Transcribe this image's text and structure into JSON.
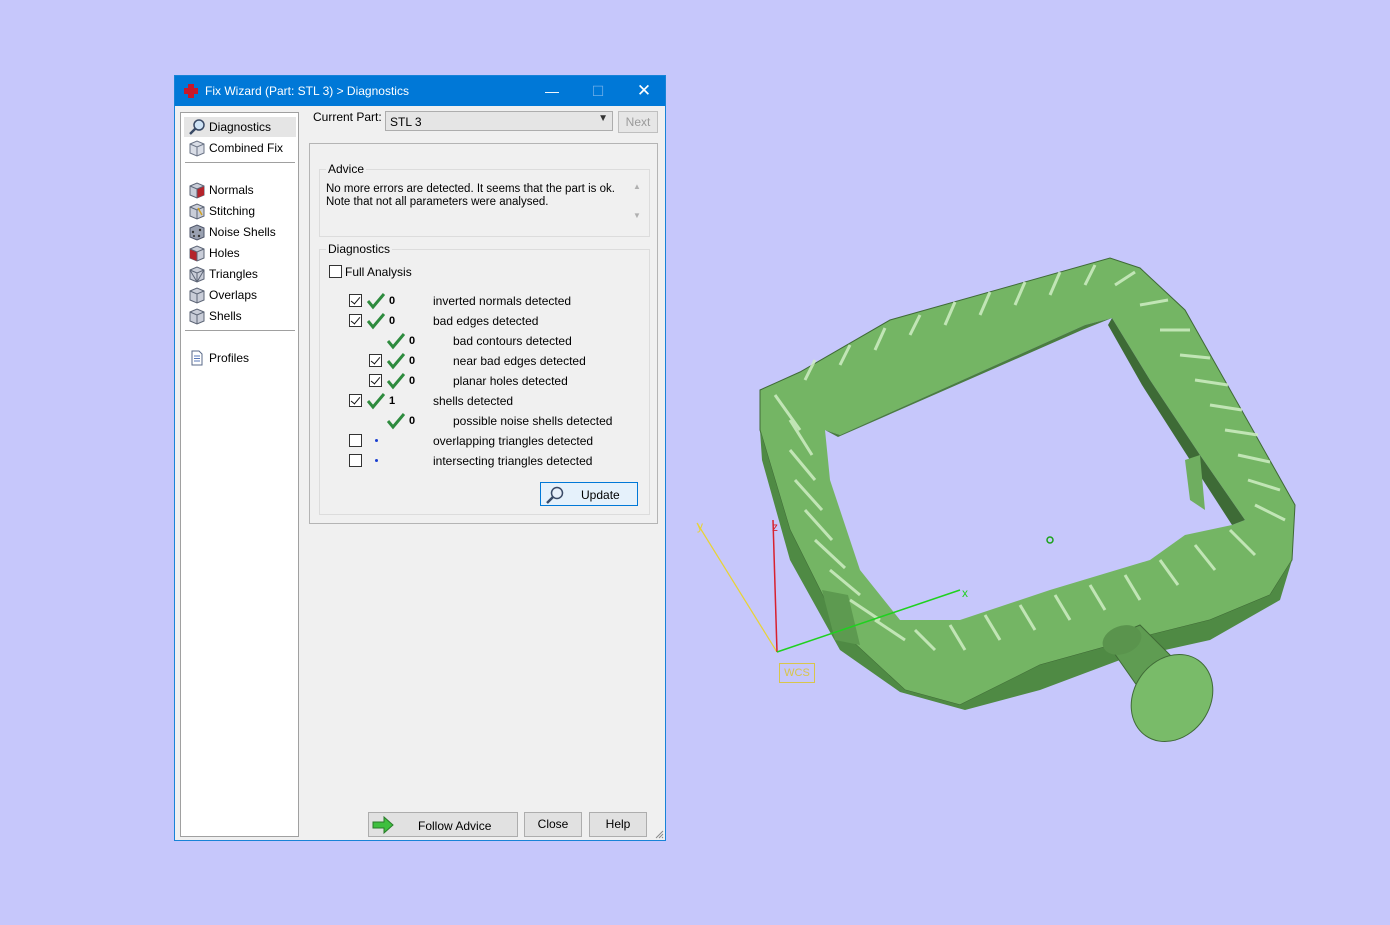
{
  "window": {
    "title": "Fix Wizard (Part: STL 3) > Diagnostics",
    "minimize_glyph": "—",
    "maximize_glyph": "☐",
    "close_glyph": "✕"
  },
  "sidebar": {
    "items": [
      {
        "label": "Diagnostics",
        "icon": "magnifier-icon",
        "selected": true
      },
      {
        "label": "Combined Fix",
        "icon": "cube-icon"
      },
      {
        "label": "Normals",
        "icon": "normals-cube-icon"
      },
      {
        "label": "Stitching",
        "icon": "stitching-cube-icon"
      },
      {
        "label": "Noise Shells",
        "icon": "noise-shells-icon"
      },
      {
        "label": "Holes",
        "icon": "holes-cube-icon"
      },
      {
        "label": "Triangles",
        "icon": "triangles-cube-icon"
      },
      {
        "label": "Overlaps",
        "icon": "overlaps-cube-icon"
      },
      {
        "label": "Shells",
        "icon": "shells-cube-icon"
      },
      {
        "label": "Profiles",
        "icon": "document-icon"
      }
    ]
  },
  "toolbar": {
    "current_part_label": "Current Part:",
    "current_part_value": "STL 3",
    "next_label": "Next"
  },
  "advice": {
    "group_label": "Advice",
    "line1": "No more errors are detected. It seems that the part is ok.",
    "line2": "Note that not all parameters were analysed."
  },
  "diagnostics": {
    "group_label": "Diagnostics",
    "full_analysis_label": "Full Analysis",
    "full_analysis_checked": false,
    "rows": [
      {
        "label": "inverted normals detected",
        "count": "0",
        "checked": true,
        "status": "ok"
      },
      {
        "label": "bad edges detected",
        "count": "0",
        "checked": true,
        "status": "ok"
      },
      {
        "label": "bad contours detected",
        "count": "0",
        "status": "ok"
      },
      {
        "label": "near bad edges detected",
        "count": "0",
        "checked": true,
        "status": "ok"
      },
      {
        "label": "planar holes detected",
        "count": "0",
        "checked": true,
        "status": "ok"
      },
      {
        "label": "shells detected",
        "count": "1",
        "checked": true,
        "status": "ok"
      },
      {
        "label": "possible noise shells detected",
        "count": "0",
        "status": "ok"
      },
      {
        "label": "overlapping triangles detected",
        "count": "",
        "checked": false,
        "status": "not-analysed"
      },
      {
        "label": "intersecting triangles detected",
        "count": "",
        "checked": false,
        "status": "not-analysed"
      }
    ],
    "update_label": "Update"
  },
  "footer": {
    "follow_advice_label": "Follow Advice",
    "close_label": "Close",
    "help_label": "Help"
  },
  "viewport": {
    "axis_x_label": "x",
    "axis_y_label": "y",
    "axis_z_label": "z",
    "wcs_label": "WCS",
    "model_color": "#7cbf6a",
    "background_color": "#c6c7fb"
  },
  "colors": {
    "titlebar": "#0078d7",
    "check_green": "#2e8b3e",
    "axis_x": "#1fd11f",
    "axis_y": "#e8d335",
    "axis_z": "#d8202e"
  }
}
